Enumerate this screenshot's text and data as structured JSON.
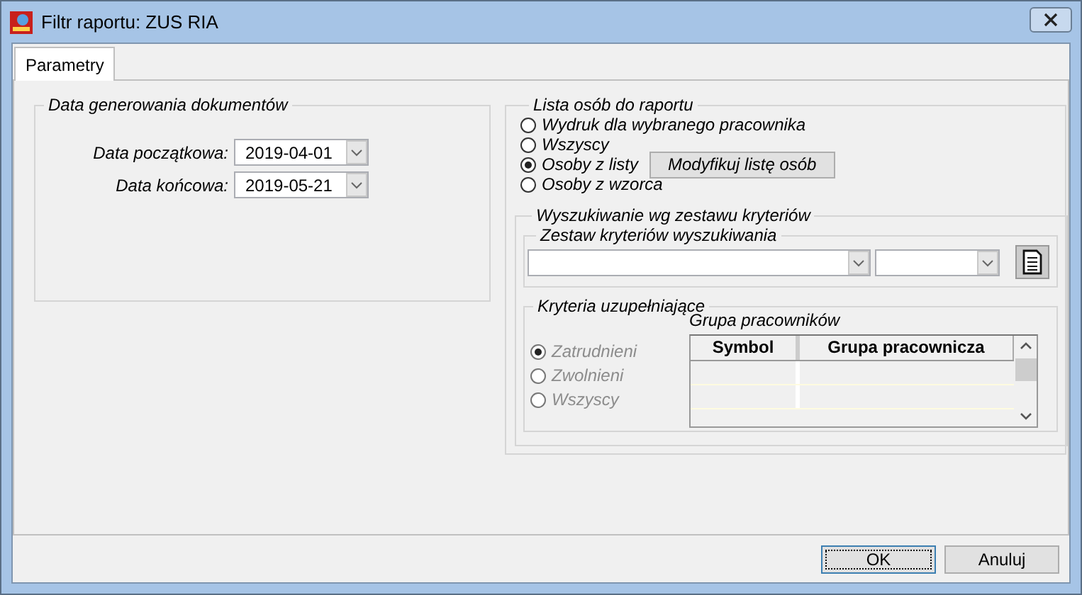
{
  "window": {
    "title": "Filtr raportu: ZUS RIA"
  },
  "tabs": [
    {
      "label": "Parametry",
      "selected": true
    }
  ],
  "date_group": {
    "title": "Data generowania dokumentów",
    "fields": [
      {
        "label": "Data początkowa:",
        "value": "2019-04-01"
      },
      {
        "label": "Data końcowa:",
        "value": "2019-05-21"
      }
    ]
  },
  "person_list": {
    "title": "Lista osób do raportu",
    "options": [
      {
        "label": "Wydruk dla wybranego pracownika",
        "selected": false
      },
      {
        "label": "Wszyscy",
        "selected": false
      },
      {
        "label": "Osoby z listy",
        "selected": true
      },
      {
        "label": "Osoby z wzorca",
        "selected": false
      }
    ],
    "modify_button": "Modyfikuj listę osób"
  },
  "search": {
    "title": "Wyszukiwanie wg zestawu kryteriów",
    "set": {
      "title": "Zestaw kryteriów wyszukiwania"
    },
    "extra": {
      "title": "Kryteria uzupełniające",
      "options": [
        {
          "label": "Zatrudnieni",
          "selected": true,
          "disabled": true
        },
        {
          "label": "Zwolnieni",
          "selected": false,
          "disabled": true
        },
        {
          "label": "Wszyscy",
          "selected": false,
          "disabled": true
        }
      ],
      "table": {
        "title": "Grupa pracowników",
        "columns": [
          "Symbol",
          "Grupa pracownicza"
        ]
      }
    }
  },
  "buttons": [
    {
      "label": "OK",
      "focused": true
    },
    {
      "label": "Anuluj",
      "focused": false
    }
  ]
}
